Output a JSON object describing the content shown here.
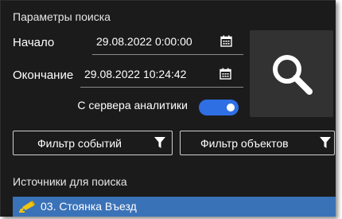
{
  "search_params": {
    "title": "Параметры поиска",
    "start_label": "Начало",
    "start_value": "29.08.2022 0:00:00",
    "end_label": "Окончание",
    "end_value": "29.08.2022 10:24:42",
    "search_icon": "search-icon"
  },
  "analytics_toggle": {
    "label": "С сервера аналитики",
    "state": "on",
    "color": "#2f6fe4"
  },
  "filters": {
    "events_label": "Фильтр событий",
    "objects_label": "Фильтр объектов",
    "icon": "funnel-icon"
  },
  "sources": {
    "title": "Источники для поиска",
    "items": [
      {
        "name": "03. Стоянка Въезд",
        "icon": "camera-icon",
        "selected": true
      }
    ]
  },
  "colors": {
    "background": "#1b1b1b",
    "accent": "#2f6fe4",
    "selection": "#3a72b8",
    "camera_icon": "#f2c40f"
  }
}
